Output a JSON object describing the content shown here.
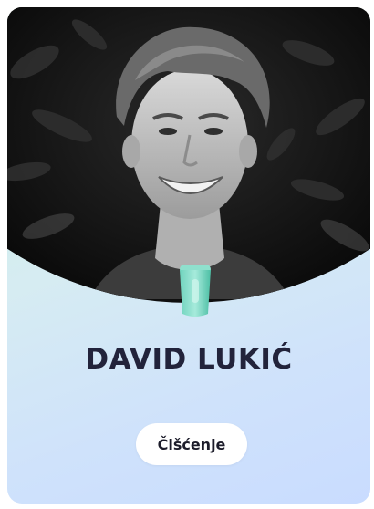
{
  "profile": {
    "name": "DAVID LUKIĆ",
    "role_label": "Čišćenje",
    "photo_icon": "profile-photo",
    "role_icon": "cleaning-container-icon"
  },
  "colors": {
    "name": "#22233b",
    "card_gradient_start": "#c9f5e1",
    "card_gradient_end": "#c9dcff",
    "pill_bg": "#ffffff",
    "badge": "#7fd9c3"
  }
}
